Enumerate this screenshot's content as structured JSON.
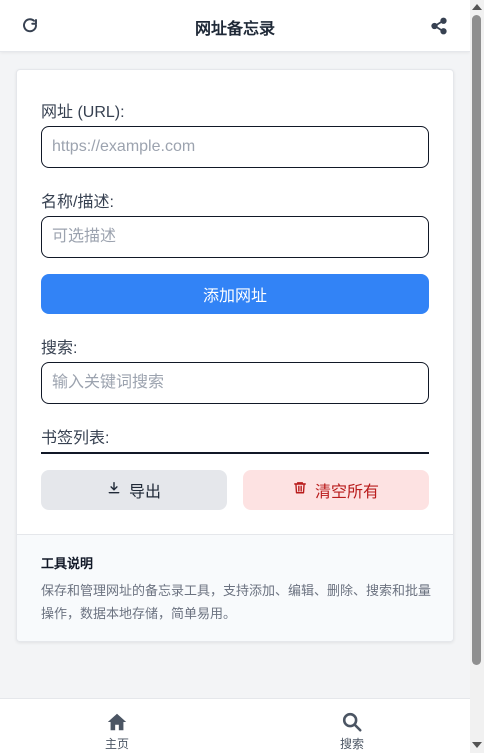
{
  "header": {
    "title": "网址备忘录",
    "refresh_icon": "refresh-icon",
    "share_icon": "share-icon"
  },
  "form": {
    "url_label": "网址 (URL):",
    "url_value": "",
    "url_placeholder": "https://example.com",
    "name_label": "名称/描述:",
    "name_value": "",
    "name_placeholder": "可选描述",
    "add_button": "添加网址",
    "search_label": "搜索:",
    "search_value": "",
    "search_placeholder": "输入关键词搜索",
    "list_label": "书签列表:",
    "export_button": "导出",
    "clear_button": "清空所有"
  },
  "tools": {
    "title": "工具说明",
    "description": "保存和管理网址的备忘录工具，支持添加、编辑、删除、搜索和批量操作，数据本地存储，简单易用。"
  },
  "bottom_nav": {
    "items": [
      {
        "label": "主页",
        "icon": "home-icon"
      },
      {
        "label": "搜索",
        "icon": "search-icon"
      }
    ]
  },
  "colors": {
    "primary": "#3283f6",
    "danger_bg": "#fde2e2",
    "danger_text": "#b91c1c",
    "neutral_btn": "#e5e7eb"
  }
}
